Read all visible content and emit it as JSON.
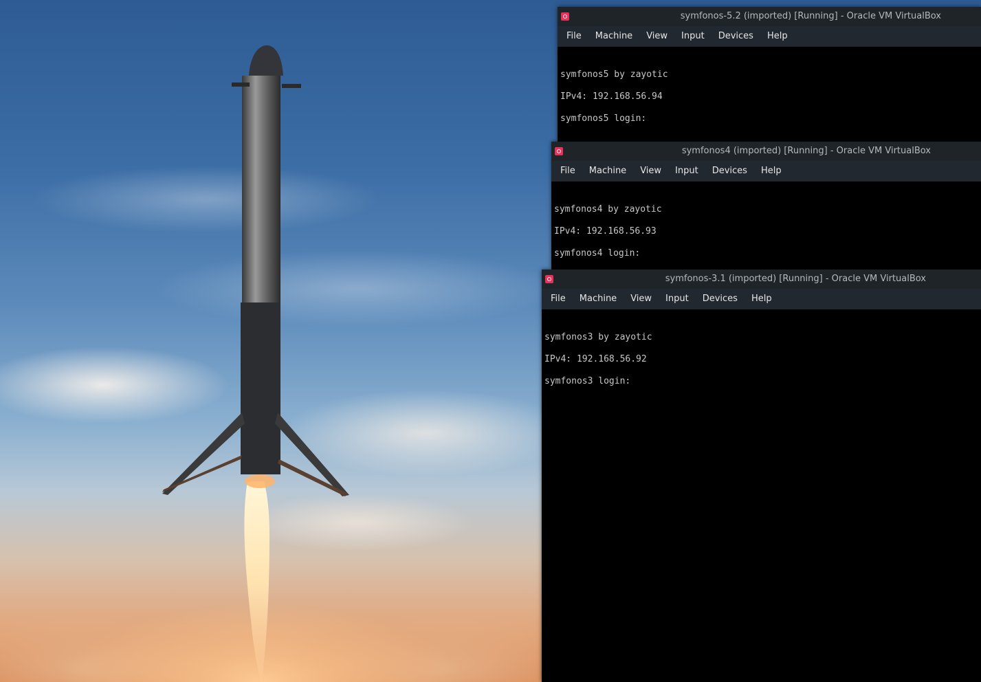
{
  "wallpaper": {
    "description_icon": "rocket-landing-photo"
  },
  "windows": [
    {
      "title": "symfonos-5.2 (imported) [Running] - Oracle VM VirtualBox",
      "menu": [
        "File",
        "Machine",
        "View",
        "Input",
        "Devices",
        "Help"
      ],
      "console": [
        "symfonos5 by zayotic",
        "IPv4: 192.168.56.94",
        "symfonos5 login:"
      ]
    },
    {
      "title": "symfonos4 (imported) [Running] - Oracle VM VirtualBox",
      "menu": [
        "File",
        "Machine",
        "View",
        "Input",
        "Devices",
        "Help"
      ],
      "console": [
        "symfonos4 by zayotic",
        "IPv4: 192.168.56.93",
        "symfonos4 login:"
      ]
    },
    {
      "title": "symfonos-3.1 (imported) [Running] - Oracle VM VirtualBox",
      "menu": [
        "File",
        "Machine",
        "View",
        "Input",
        "Devices",
        "Help"
      ],
      "console": [
        "symfonos3 by zayotic",
        "IPv4: 192.168.56.92",
        "symfonos3 login:"
      ]
    }
  ],
  "colors": {
    "titlebar": "#1f2429",
    "menubar": "#222830",
    "app_icon": "#e8305a",
    "console_bg": "#000000"
  }
}
